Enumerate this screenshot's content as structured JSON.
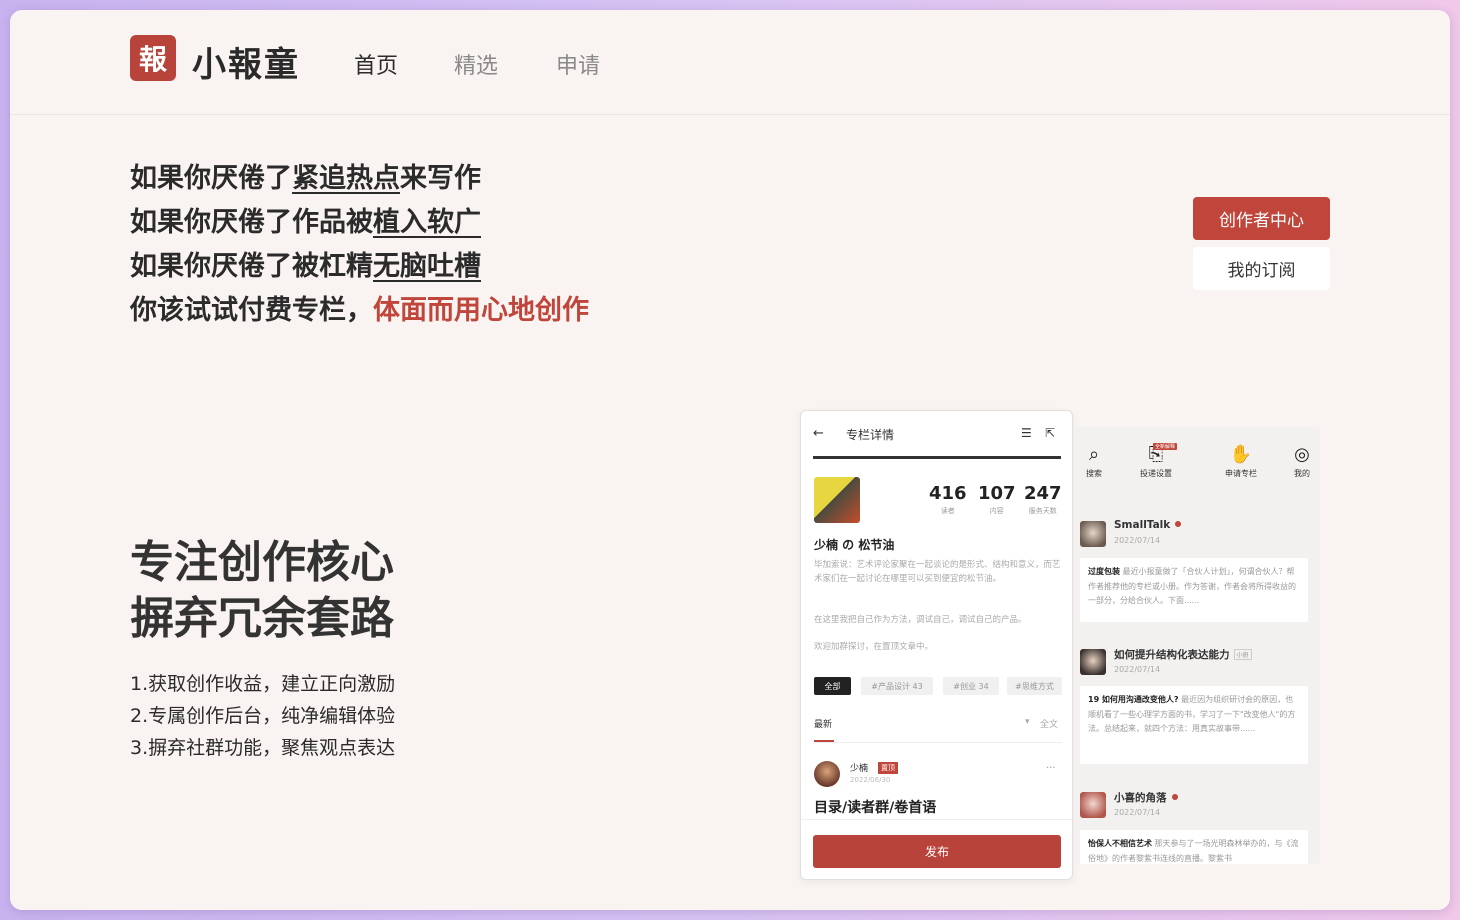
{
  "header": {
    "logo_glyph": "報",
    "brand": "小報童",
    "nav": [
      "首页",
      "精选",
      "申请"
    ]
  },
  "hero": {
    "line1_prefix": "如果你厌倦了",
    "line1_link": "紧追热点",
    "line1_suffix": "来写作",
    "line2_prefix": "如果你厌倦了作品被",
    "line2_link": "植入软广",
    "line3_prefix": "如果你厌倦了被杠精",
    "line3_link": "无脑吐槽",
    "line4_prefix": "你该试试付费专栏，",
    "line4_highlight": "体面而用心地创作"
  },
  "buttons": {
    "creator_center": "创作者中心",
    "my_subscriptions": "我的订阅"
  },
  "focus": {
    "title_line1": "专注创作核心",
    "title_line2": "摒弃冗余套路",
    "features": [
      "1.获取创作收益，建立正向激励",
      "2.专属创作后台，纯净编辑体验",
      "3.摒弃社群功能，聚焦观点表达"
    ]
  },
  "phone1": {
    "back": "←",
    "title": "专栏详情",
    "icon_settings": "☰",
    "icon_share": "⇱",
    "stats": [
      {
        "value": "416",
        "label": "读者"
      },
      {
        "value": "107",
        "label": "内容"
      },
      {
        "value": "247",
        "label": "服务天数"
      }
    ],
    "author_title": "少楠 の 松节油",
    "desc1": "毕加索说：艺术评论家聚在一起谈论的是形式、结构和意义，而艺术家们在一起讨论在哪里可以买到便宜的松节油。",
    "desc2": "在这里我把自己作为方法，调试自己，调试自己的产品。",
    "desc3": "欢迎加群探讨，在置顶文章中。",
    "tags": [
      "全部",
      "#产品设计 43",
      "#创业 34",
      "#思维方式"
    ],
    "sort_label": "最新",
    "filter_label": "全文",
    "post": {
      "author": "少楠",
      "badge": "置顶",
      "date": "2022/06/30",
      "more": "···",
      "title": "目录/读者群/卷首语"
    },
    "publish": "发布"
  },
  "phone2": {
    "tabs": [
      {
        "icon": "search-icon",
        "glyph": "⌕",
        "label": "搜索"
      },
      {
        "icon": "delivery-icon",
        "glyph": "⎘",
        "label": "投递设置"
      },
      {
        "icon": "hand-icon",
        "glyph": "✋",
        "label": "申请专栏"
      },
      {
        "icon": "user-icon",
        "glyph": "◎",
        "label": "我的"
      }
    ],
    "tab_badge": "全新解释",
    "feed": [
      {
        "name": "SmallTalk",
        "date": "2022/07/14",
        "card_title": "过度包装",
        "card_text": " 最近小报童做了「合伙人计划」，何谓合伙人？帮作者推荐他的专栏或小册。作为答谢，作者会将所得收益的一部分，分给合伙人。下面......"
      },
      {
        "name": "如何提升结构化表达能力",
        "mini": "小册",
        "date": "2022/07/14",
        "card_title": "19 如何用沟通改变他人?",
        "card_text": " 最近因为组织研讨会的原因，也顺机看了一些心理学方面的书，学习了一下\"改变他人\"的方法。总结起来，就四个方法：用真实故事带......"
      },
      {
        "name": "小喜的角落",
        "date": "2022/07/14",
        "card_title": "怡保人不相信艺术",
        "card_text": " 那天参与了一场光明森林举办的，与《流俗地》的作者黎紫书连线的直播。黎紫书"
      }
    ]
  },
  "colors": {
    "accent": "#c0453a",
    "page_bg": "#f9f4f2",
    "outer_gradient": [
      "#c8b3ef",
      "#f0c8ea"
    ]
  }
}
